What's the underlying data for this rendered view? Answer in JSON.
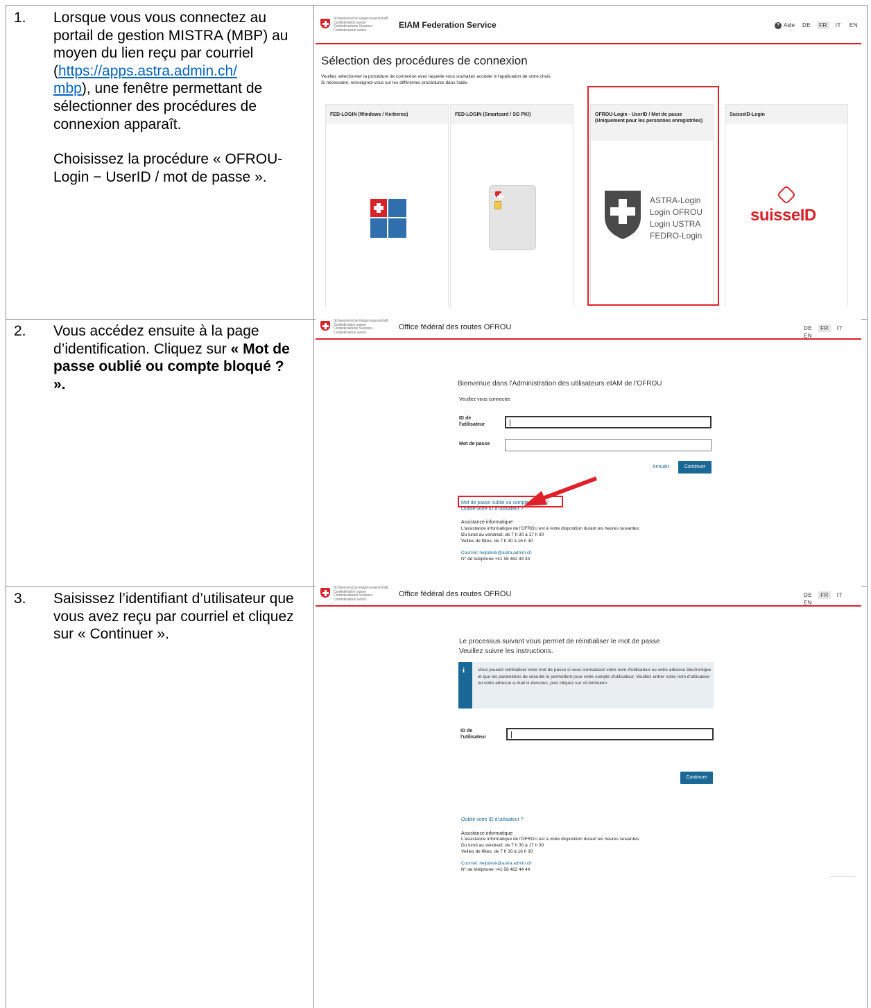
{
  "steps": [
    {
      "number": "1.",
      "text_a": "Lorsque vous vous connectez au portail de gestion MISTRA (MBP) au moyen du lien reçu par courriel (",
      "link": "https://apps.astra.admin.ch/mbp",
      "link_line1": "https://apps.astra.admin.ch/",
      "link_line2": "mbp",
      "text_b": "), une fenêtre permettant de sélectionner des procédures de connexion apparaît.",
      "text_c": "Choisissez la procédure « OFROU-Login − UserID / mot de passe »."
    },
    {
      "number": "2.",
      "text_a": "Vous accédez ensuite à la page d’identification. Cliquez sur ",
      "text_bold": "« Mot de passe oublié ou compte bloqué ? »."
    },
    {
      "number": "3.",
      "text_a": "Saisissez l’identifiant d’utilisateur que vous avez reçu par courriel et cliquez sur « Continuer »."
    }
  ],
  "confederation_lines": [
    "Schweizerische Eidgenossenschaft",
    "Confédération suisse",
    "Confederazione Svizzera",
    "Confederaziun svizra"
  ],
  "shot1": {
    "app_title": "EIAM Federation Service",
    "help_label": "Aide",
    "languages": [
      "DE",
      "FR",
      "IT",
      "EN"
    ],
    "active_language": "FR",
    "heading": "Sélection des procédures de connexion",
    "intro_line1": "Veuillez sélectionner la procédure de connexion avec laquelle vous souhaitez accéder à l'application de votre choix.",
    "intro_line2": "Si nécessaire, renseignez-vous sur les différentes procédures dans l'aide.",
    "cards": [
      {
        "title": "FED-LOGIN (Windows / Kerberos)",
        "icon": "windows-icon"
      },
      {
        "title": "FED-LOGIN (Smartcard / SG PKI)",
        "icon": "smartcard-icon"
      },
      {
        "title": "OFROU-Login - UserID / Mot de passe (Uniquement pour les personnes enregistrées)",
        "icon": "swiss-shield-icon",
        "logo_lines": [
          "ASTRA-Login",
          "Login OFROU",
          "Login USTRA",
          "FEDRO-Login"
        ]
      },
      {
        "title": "SuisseID-Login",
        "icon": "suisseid-logo",
        "logo_text": "suisseID"
      }
    ]
  },
  "shot2": {
    "app_title": "Office fédéral des routes OFROU",
    "languages": [
      "DE",
      "FR",
      "IT",
      "EN"
    ],
    "active_language": "FR",
    "welcome": "Bienvenue dans l'Administration des utilisateurs eIAM de l'OFROU",
    "prompt": "Veuillez vous connecter.",
    "userid_label_1": "ID de",
    "userid_label_2": "l'utilisateur",
    "password_label": "Mot de passe",
    "cancel_label": "Annuler",
    "continue_label": "Continuer",
    "forgot_password": "Mot de passe oublié ou compte bloqué ?",
    "forgot_userid": "Oublié votre ID d'utilisateur ?",
    "support_title": "Assistance informatique",
    "support_text": "L'assistance informatique de l'OFROU est à votre disposition durant les heures suivantes:",
    "hours_1": "Du lundi au vendredi: de 7 h 30 à 17 h 30",
    "hours_2": "Veilles de fêtes, de 7 h 30 à 16 h 30",
    "email": "Courriel: helpdesk@astra.admin.ch",
    "phone": "N° de téléphone +41 58 462 44 44"
  },
  "shot3": {
    "app_title": "Office fédéral des routes OFROU",
    "languages": [
      "DE",
      "FR",
      "IT",
      "EN"
    ],
    "active_language": "FR",
    "intro_1": "Le processus suivant vous permet de réinitialiser le mot de passe",
    "intro_2": "Veuillez suivre les instructions.",
    "info_text": "Vous pouvez réinitialiser votre mot de passe si vous connaissez votre nom d'utilisateur ou votre adresse électronique et que les paramètres de sécurité le permettent pour votre compte d'utilisateur. Veuillez entrer votre nom d'utilisateur ou votre adresse e-mail ci-dessous, puis cliquez sur «Continuer».",
    "userid_label_1": "ID de",
    "userid_label_2": "l'utilisateur",
    "continue_label": "Continuer",
    "forgot_userid": "Oublié votre ID d'utilisateur ?",
    "support_title": "Assistance informatique",
    "support_text": "L'assistance informatique de l'OFROU est à votre disposition durant les heures suivantes:",
    "hours_1": "Du lundi au vendredi: de 7 h 30 à 17 h 30",
    "hours_2": "Veilles de fêtes, de 7 h 30 à 16 h 30",
    "email": "Courriel: helpdesk@astra.admin.ch",
    "phone": "N° de téléphone +41 58 462 44 44"
  },
  "colors": {
    "swiss_red": "#d8232a",
    "highlight_red": "#e0202a",
    "primary_button": "#1a6896",
    "link_blue": "#0563c1"
  }
}
